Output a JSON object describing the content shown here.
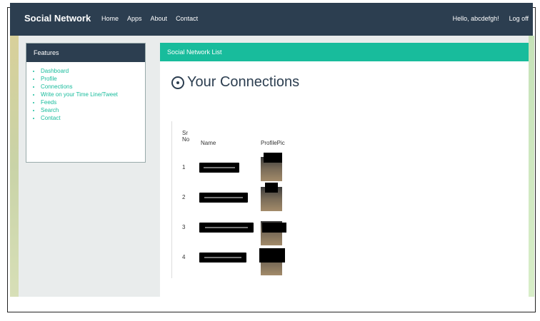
{
  "navbar": {
    "brand": "Social Network",
    "links": [
      "Home",
      "Apps",
      "About",
      "Contact"
    ],
    "greeting": "Hello, abcdefgh!",
    "logout": "Log off"
  },
  "sidebar": {
    "title": "Features",
    "items": [
      "Dashboard",
      "Profile",
      "Connections",
      "Write on your Time Line/Tweet",
      "Feeds",
      "Search",
      "Contact"
    ]
  },
  "panel": {
    "header": "Social Network List",
    "title": "Your Connections",
    "table": {
      "columns": [
        "Sr No",
        "Name",
        "ProfilePic"
      ],
      "rows": [
        {
          "no": "1"
        },
        {
          "no": "2"
        },
        {
          "no": "3"
        },
        {
          "no": "4"
        }
      ]
    }
  },
  "colors": {
    "navbar_bg": "#2c3e50",
    "accent": "#18bc9c"
  }
}
